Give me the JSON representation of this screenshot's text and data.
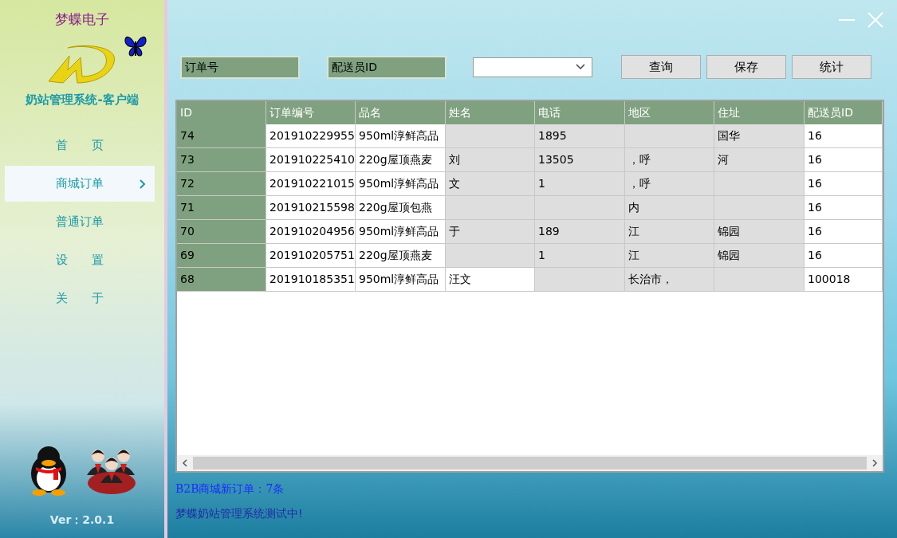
{
  "brand": {
    "company": "梦蝶电子",
    "system": "奶站管理系统-客户端"
  },
  "nav": [
    {
      "label": "首　　页",
      "selected": false
    },
    {
      "label": "商城订单",
      "selected": true
    },
    {
      "label": "普通订单",
      "selected": false
    },
    {
      "label": "设　　置",
      "selected": false
    },
    {
      "label": "关　　于",
      "selected": false
    }
  ],
  "version": "Ver：2.0.1",
  "filters": {
    "order_no": {
      "placeholder": "订单号"
    },
    "courier_id": {
      "placeholder": "配送员ID"
    }
  },
  "buttons": [
    "查询",
    "保存",
    "统计"
  ],
  "table": {
    "columns": [
      "ID",
      "订单编号",
      "品名",
      "姓名",
      "电话",
      "地区",
      "住址",
      "配送员ID"
    ],
    "rows": [
      [
        {
          "text": "74"
        },
        {
          "text": "201910229955"
        },
        {
          "text": "950ml淳鲜高品"
        },
        {
          "masked": true
        },
        {
          "text": "1895",
          "masked": true
        },
        {
          "masked": true
        },
        {
          "text": "国华",
          "masked": true
        },
        {
          "text": "16"
        }
      ],
      [
        {
          "text": "73"
        },
        {
          "text": "201910225410"
        },
        {
          "text": "220g屋顶燕麦"
        },
        {
          "text": "刘",
          "masked": true
        },
        {
          "text": "13505",
          "masked": true
        },
        {
          "text": "，呼",
          "masked": true
        },
        {
          "text": "河",
          "masked": true
        },
        {
          "text": "16"
        }
      ],
      [
        {
          "text": "72"
        },
        {
          "text": "201910221015"
        },
        {
          "text": "950ml淳鲜高品"
        },
        {
          "text": "文",
          "masked": true
        },
        {
          "text": "1",
          "masked": true
        },
        {
          "text": "，呼",
          "masked": true
        },
        {
          "masked": true
        },
        {
          "text": "16"
        }
      ],
      [
        {
          "text": "71"
        },
        {
          "text": "201910215598"
        },
        {
          "text": "220g屋顶包燕"
        },
        {
          "masked": true
        },
        {
          "masked": true
        },
        {
          "text": "内",
          "masked": true
        },
        {
          "masked": true
        },
        {
          "text": "16"
        }
      ],
      [
        {
          "text": "70"
        },
        {
          "text": "201910204956"
        },
        {
          "text": "950ml淳鲜高品"
        },
        {
          "text": "于",
          "masked": true
        },
        {
          "text": "189",
          "masked": true
        },
        {
          "text": "江",
          "masked": true
        },
        {
          "text": "锦园",
          "masked": true
        },
        {
          "text": "16"
        }
      ],
      [
        {
          "text": "69"
        },
        {
          "text": "201910205751"
        },
        {
          "text": "220g屋顶燕麦"
        },
        {
          "masked": true
        },
        {
          "text": "1",
          "masked": true
        },
        {
          "text": "江",
          "masked": true
        },
        {
          "text": "锦园",
          "masked": true
        },
        {
          "text": "16"
        }
      ],
      [
        {
          "text": "68"
        },
        {
          "text": "201910185351"
        },
        {
          "text": "950ml淳鲜高品"
        },
        {
          "text": "汪文"
        },
        {
          "masked": true
        },
        {
          "text": "长治市，",
          "masked": true
        },
        {
          "masked": true
        },
        {
          "text": "100018"
        }
      ]
    ]
  },
  "status": [
    "B2B商城新订单：7条",
    "梦蝶奶站管理系统测试中!"
  ]
}
